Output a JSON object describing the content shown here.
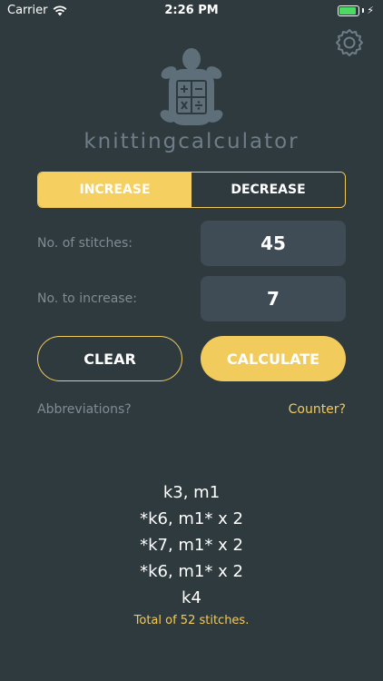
{
  "status_bar": {
    "carrier": "Carrier",
    "time": "2:26 PM",
    "battery_level": 0.9
  },
  "icons": {
    "wifi": "wifi-icon",
    "battery": "battery-icon",
    "charging": "charging-bolt-icon",
    "settings": "gear-icon",
    "logo": "turtle-calculator-logo"
  },
  "brand": "knittingcalculator",
  "mode_tabs": [
    {
      "label": "INCREASE",
      "active": true
    },
    {
      "label": "DECREASE",
      "active": false
    }
  ],
  "fields": {
    "stitches_label": "No. of stitches:",
    "stitches_value": "45",
    "increase_label": "No. to increase:",
    "increase_value": "7"
  },
  "buttons": {
    "clear": "CLEAR",
    "calculate": "CALCULATE"
  },
  "links": {
    "abbreviations": "Abbreviations?",
    "counter": "Counter?"
  },
  "result_lines": [
    "k3, m1",
    "*k6, m1* x 2",
    "*k7, m1* x 2",
    "*k6, m1* x 2",
    "k4"
  ],
  "total": "Total of 52 stitches.",
  "colors": {
    "background": "#2f3a3f",
    "accent": "#f2cb5d",
    "field": "#3f4b55",
    "muted_text": "#7f8c94"
  }
}
